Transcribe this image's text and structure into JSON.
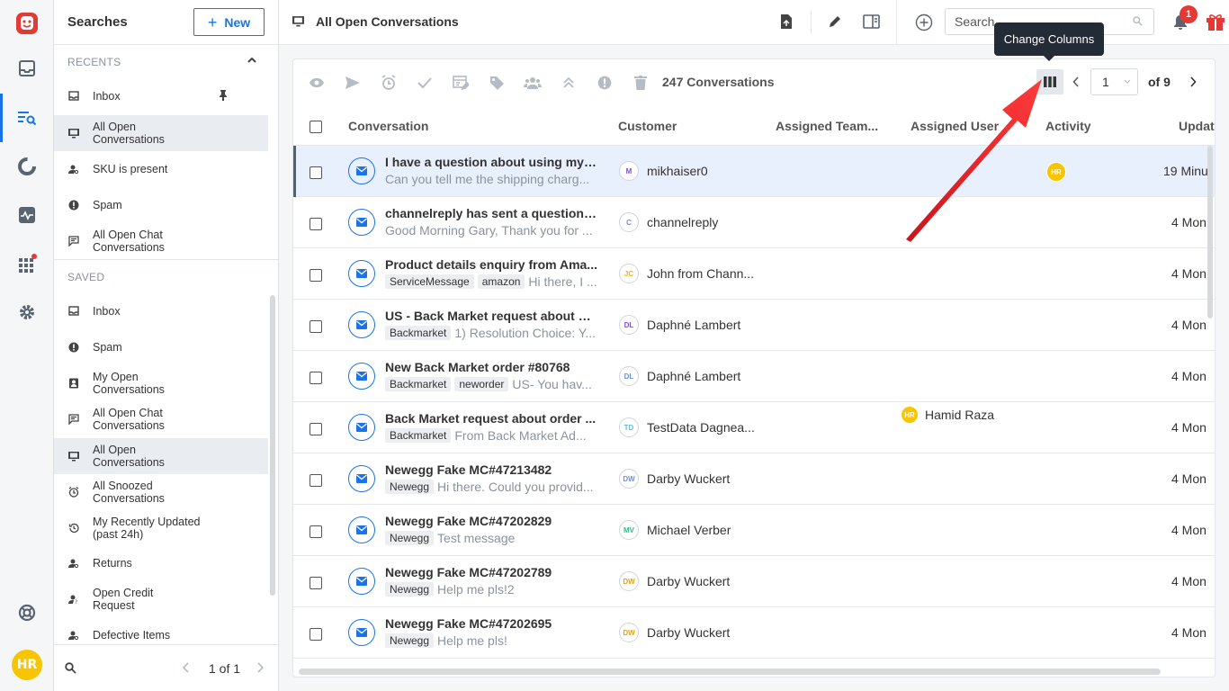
{
  "rail": {
    "items": [
      "inbox-icon",
      "search-list-icon",
      "chart-icon",
      "activity-icon",
      "apps-icon",
      "gear-icon"
    ],
    "help_icon": "lifebuoy-icon",
    "user_initials": "HR"
  },
  "panel": {
    "title": "Searches",
    "new_label": "New",
    "recents_label": "RECENTS",
    "saved_label": "SAVED",
    "recents": [
      {
        "label": "Inbox",
        "icon": "inbox-icon"
      },
      {
        "label": "All Open Conversations",
        "icon": "monitor-icon"
      },
      {
        "label": "SKU is present",
        "icon": "user-search-icon"
      },
      {
        "label": "Spam",
        "icon": "alert-icon"
      },
      {
        "label": "All Open Chat Conversations",
        "icon": "chat-icon"
      }
    ],
    "saved": [
      {
        "label": "Inbox",
        "icon": "inbox-icon"
      },
      {
        "label": "Spam",
        "icon": "alert-icon"
      },
      {
        "label": "My Open Conversations",
        "icon": "contact-icon"
      },
      {
        "label": "All Open Chat Conversations",
        "icon": "chat-icon"
      },
      {
        "label": "All Open Conversations",
        "icon": "monitor-icon"
      },
      {
        "label": "All Snoozed Conversations",
        "icon": "alarm-icon"
      },
      {
        "label": "My Recently Updated (past 24h)",
        "icon": "history-icon"
      },
      {
        "label": "Returns",
        "icon": "user-search-icon"
      },
      {
        "label": "Open Credit Request",
        "icon": "user-question-icon"
      },
      {
        "label": "Defective Items",
        "icon": "user-search-icon"
      }
    ],
    "footer_pager": "1 of 1"
  },
  "topbar": {
    "view_title": "All Open Conversations",
    "search_placeholder": "Search",
    "notif_count": "1"
  },
  "toolbar": {
    "count_label": "247 Conversations",
    "page_value": "1",
    "page_of": "of 9",
    "tooltip": "Change Columns"
  },
  "table": {
    "headers": {
      "conversation": "Conversation",
      "customer": "Customer",
      "team": "Assigned Team...",
      "user": "Assigned User",
      "activity": "Activity",
      "updated": "Updat"
    },
    "rows": [
      {
        "subject": "I have a question about using my it...",
        "tags": [],
        "preview": "Can you tell me the shipping charg...",
        "initials": "M",
        "color": "#7b4fd6",
        "customer": "mikhaiser0",
        "user": "",
        "activity": "HR",
        "updated": "19 Minu"
      },
      {
        "subject": "channelreply has sent a question ...",
        "tags": [],
        "preview": "Good Morning Gary, Thank you for ...",
        "initials": "C",
        "color": "#6a8fd8",
        "customer": "channelreply",
        "user": "",
        "activity": "",
        "updated": "4 Mon"
      },
      {
        "subject": "Product details enquiry from Ama...",
        "tags": [
          "ServiceMessage",
          "amazon"
        ],
        "preview": "Hi there, I ...",
        "initials": "JC",
        "color": "#f0b400",
        "customer": "John from Chann...",
        "user": "",
        "activity": "",
        "updated": "4 Mon"
      },
      {
        "subject": "US - Back Market request about or...",
        "tags": [
          "Backmarket"
        ],
        "preview": "1) Resolution Choice: Y...",
        "initials": "DL",
        "color": "#7b4fd6",
        "customer": "Daphné Lambert",
        "user": "",
        "activity": "",
        "updated": "4 Mon"
      },
      {
        "subject": "New Back Market order #80768",
        "tags": [
          "Backmarket",
          "neworder"
        ],
        "preview": "US- You hav...",
        "initials": "DL",
        "color": "#6a8fd8",
        "customer": "Daphné Lambert",
        "user": "",
        "activity": "",
        "updated": "4 Mon"
      },
      {
        "subject": "Back Market request about order ...",
        "tags": [
          "Backmarket"
        ],
        "preview": "From Back Market Ad...",
        "initials": "TD",
        "color": "#4ec7d8",
        "customer": "TestData Dagnea...",
        "user": "Hamid Raza",
        "activity": "",
        "updated": "4 Mon"
      },
      {
        "subject": "Newegg Fake MC#47213482",
        "tags": [
          "Newegg"
        ],
        "preview": "Hi there. Could you provid...",
        "initials": "DW",
        "color": "#6a8fd8",
        "customer": "Darby Wuckert",
        "user": "",
        "activity": "",
        "updated": "4 Mon"
      },
      {
        "subject": "Newegg Fake MC#47202829",
        "tags": [
          "Newegg"
        ],
        "preview": "Test message",
        "initials": "MV",
        "color": "#2bbf8a",
        "customer": "Michael Verber",
        "user": "",
        "activity": "",
        "updated": "4 Mon"
      },
      {
        "subject": "Newegg Fake MC#47202789",
        "tags": [
          "Newegg"
        ],
        "preview": "Help me pls!2",
        "initials": "DW",
        "color": "#f0a000",
        "customer": "Darby Wuckert",
        "user": "",
        "activity": "",
        "updated": "4 Mon"
      },
      {
        "subject": "Newegg Fake MC#47202695",
        "tags": [
          "Newegg"
        ],
        "preview": "Help me pls!",
        "initials": "DW",
        "color": "#f0a000",
        "customer": "Darby Wuckert",
        "user": "",
        "activity": "",
        "updated": "4 Mon"
      }
    ]
  },
  "colors": {
    "accent": "#1a73e8",
    "brand": "#e53935",
    "avatar": "#f9c400"
  }
}
